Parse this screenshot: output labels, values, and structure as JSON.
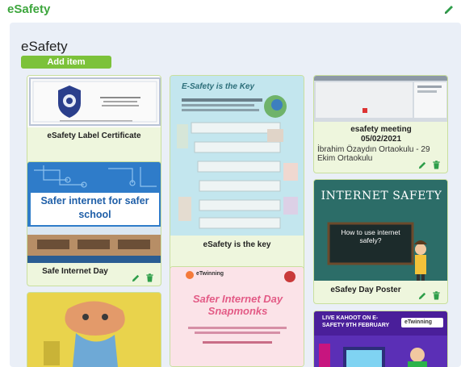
{
  "app": {
    "title": "eSafety"
  },
  "board": {
    "title": "eSafety",
    "add_item_label": "Add item"
  },
  "cards": {
    "c1": {
      "title": "eSafety Label Certificate"
    },
    "c2": {
      "title": "eSafety is the key",
      "poster_heading": "E-Safety is the Key"
    },
    "c3": {
      "title": "esafety meeting 05/02/2021",
      "subtitle": "İbrahim Özaydın Ortaokulu - 29 Ekim Ortaokulu"
    },
    "c4": {
      "title": "Safe Internet Day",
      "banner": "Safer internet for safer school"
    },
    "c5": {
      "title": "eSafey Day Poster",
      "poster_heading": "INTERNET SAFETY",
      "board_text": "How to use internet safely?"
    },
    "c6": {
      "poster_heading": "Safer Internet Day Snapmonks",
      "brand": "eTwinning"
    },
    "c7": {
      "poster_heading": "LIVE KAHOOT ON E-SAFETY 9TH FEBRUARY",
      "brand": "eTwinning"
    },
    "c8": {}
  },
  "colors": {
    "accent": "#3da63d",
    "button": "#7cc23a",
    "panel": "#eaeff7",
    "card": "#eef6dd"
  },
  "icons": {
    "edit": "pencil-icon",
    "delete": "trash-icon"
  }
}
